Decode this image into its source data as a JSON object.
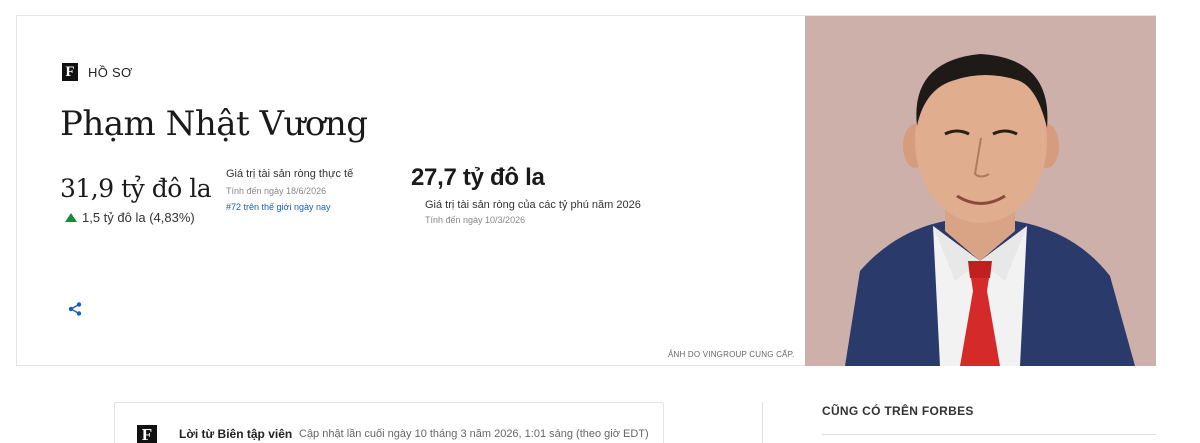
{
  "profile": {
    "section_label": "HỒ SƠ",
    "logo_letter": "F",
    "name": "Phạm Nhật Vương",
    "realtime": {
      "value": "31,9 tỷ đô la",
      "change": "1,5 tỷ đô la (4,83%)",
      "direction": "up",
      "title": "Giá trị tài sản ròng thực tế",
      "as_of": "Tính đến ngày 18/6/2026",
      "rank": "#72 trên thế giới ngày nay"
    },
    "annual": {
      "value": "27,7 tỷ đô la",
      "title": "Giá trị tài sản ròng của các tỷ phú năm 2026",
      "as_of": "Tính đến ngày 10/3/2026"
    },
    "share_icon": "share-icon",
    "photo_credit": "ẢNH DO VINGROUP CUNG CẤP."
  },
  "editor": {
    "logo_letter": "F",
    "heading": "Lời từ Biên tập viên",
    "updated": "Cập nhật lần cuối ngày 10 tháng 3 năm 2026, 1:01 sáng (theo giờ EDT)"
  },
  "sidebar": {
    "heading": "CŨNG CÓ TRÊN FORBES"
  },
  "colors": {
    "up": "#1a8a34",
    "link": "#1a5fb4",
    "photo_bg": "#cfb2ac",
    "suit": "#2a3a6a",
    "tie": "#d42a2a"
  }
}
